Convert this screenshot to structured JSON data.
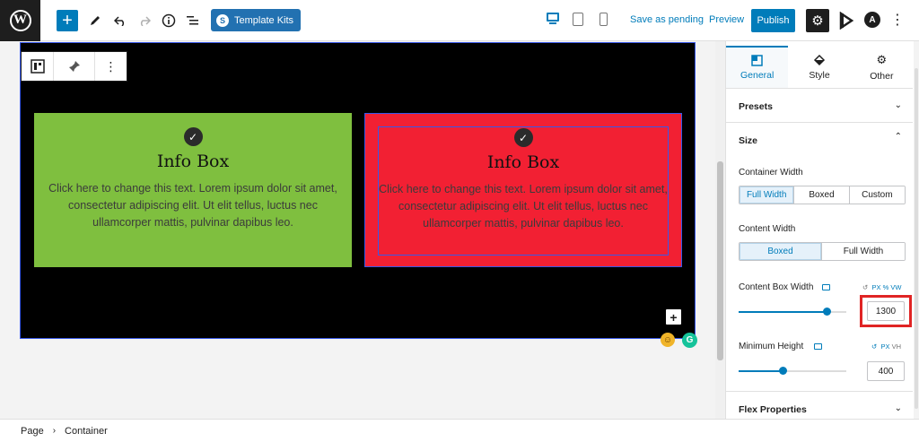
{
  "toolbar": {
    "template_kits_label": "Template Kits",
    "save_pending_label": "Save as pending",
    "preview_label": "Preview",
    "publish_label": "Publish"
  },
  "canvas": {
    "info_boxes": [
      {
        "title": "Info Box",
        "text": "Click here to change this text. Lorem ipsum dolor sit amet, consectetur adipiscing elit. Ut elit tellus, luctus nec ullamcorper mattis, pulvinar dapibus leo.",
        "background": "#7fbf3f"
      },
      {
        "title": "Info Box",
        "text": "Click here to change this text. Lorem ipsum dolor sit amet, consectetur adipiscing elit. Ut elit tellus, luctus nec ullamcorper mattis, pulvinar dapibus leo.",
        "background": "#f22033"
      }
    ]
  },
  "sidebar": {
    "tabs": [
      {
        "label": "General",
        "icon": "layout-icon",
        "active": true
      },
      {
        "label": "Style",
        "icon": "paint-bucket-icon",
        "active": false
      },
      {
        "label": "Other",
        "icon": "gear-icon",
        "active": false
      }
    ],
    "presets_label": "Presets",
    "size_label": "Size",
    "container_width": {
      "label": "Container Width",
      "options": [
        "Full Width",
        "Boxed",
        "Custom"
      ],
      "selected": "Full Width"
    },
    "content_width": {
      "label": "Content Width",
      "options": [
        "Boxed",
        "Full Width"
      ],
      "selected": "Boxed"
    },
    "content_box_width": {
      "label": "Content Box Width",
      "units": [
        "PX",
        "%",
        "VW"
      ],
      "value": "1300",
      "slider_fraction": 0.82
    },
    "minimum_height": {
      "label": "Minimum Height",
      "units": [
        "PX",
        "VH"
      ],
      "value": "400",
      "slider_fraction": 0.41
    },
    "flex_properties_label": "Flex Properties"
  },
  "breadcrumb": {
    "items": [
      "Page",
      "Container"
    ]
  },
  "colors": {
    "accent": "#007cba",
    "highlight": "#e02424"
  }
}
